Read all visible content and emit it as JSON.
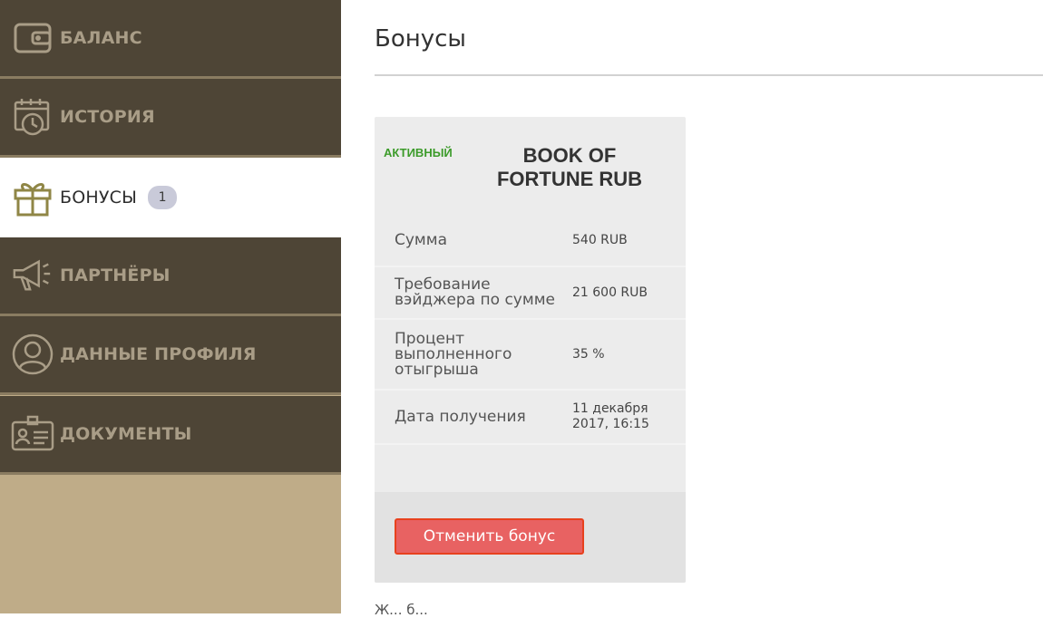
{
  "sidebar": {
    "items": [
      {
        "label": "БАЛАНС",
        "icon": "wallet-icon",
        "active": false
      },
      {
        "label": "ИСТОРИЯ",
        "icon": "calendar-clock-icon",
        "active": false
      },
      {
        "label": "БОНУСЫ",
        "icon": "gift-icon",
        "active": true,
        "badge": "1"
      },
      {
        "label": "ПАРТНЁРЫ",
        "icon": "megaphone-icon",
        "active": false
      },
      {
        "label": "ДАННЫЕ ПРОФИЛЯ",
        "icon": "user-circle-icon",
        "active": false
      },
      {
        "label": "ДОКУМЕНТЫ",
        "icon": "id-card-icon",
        "active": false
      }
    ]
  },
  "main": {
    "title": "Бонусы",
    "bonus": {
      "status": "АКТИВНЫЙ",
      "status_color": "#3c9b2a",
      "name": "BOOK OF FORTUNE RUB",
      "rows": [
        {
          "label": "Сумма",
          "value": "540 RUB"
        },
        {
          "label": "Требование вэйджера по сумме",
          "value": "21 600 RUB"
        },
        {
          "label": "Процент выполненного отыгрыша",
          "value": "35 %"
        },
        {
          "label": "Дата получения",
          "value": "11 декабря 2017, 16:15"
        }
      ],
      "cancel_label": "Отменить бонус"
    },
    "footnote": "Ж... б..."
  },
  "colors": {
    "sidebar_bg": "#4e4536",
    "sidebar_filler": "#bfac88",
    "accent_button": "#e86262"
  }
}
